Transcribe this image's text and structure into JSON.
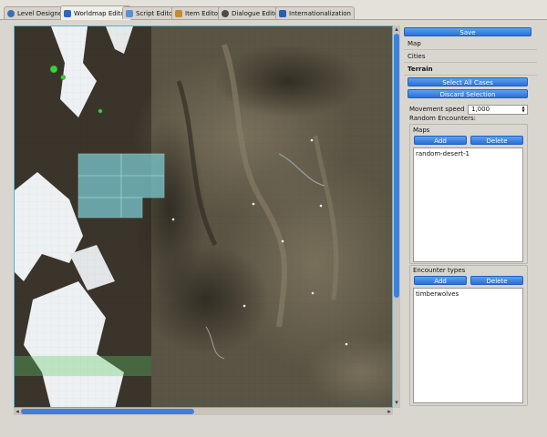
{
  "tabs": [
    {
      "label": "Level Designer",
      "icon": "globe-icon",
      "color": "#3a6fb0"
    },
    {
      "label": "Worldmap Editor",
      "icon": "map-flag-icon",
      "color": "#2d66c4",
      "active": true
    },
    {
      "label": "Script Editor",
      "icon": "script-icon",
      "color": "#5b8fd6"
    },
    {
      "label": "Item Editor",
      "icon": "box-icon",
      "color": "#c78a2d"
    },
    {
      "label": "Dialogue Editor",
      "icon": "speech-icon",
      "color": "#4a4a4a"
    },
    {
      "label": "Internationalization",
      "icon": "flag-icon",
      "color": "#2a5db8"
    }
  ],
  "panel": {
    "save_label": "Save",
    "sections": [
      "Map",
      "Cities",
      "Terrain"
    ],
    "select_all_label": "Select All Cases",
    "discard_label": "Discard Selection",
    "movement_speed_label": "Movement speed",
    "movement_speed_value": "1,000",
    "random_encounters_label": "Random Encounters:",
    "maps": {
      "title": "Maps",
      "add_label": "Add",
      "delete_label": "Delete",
      "items": [
        "random-desert-1"
      ]
    },
    "encounter_types": {
      "title": "Encounter types",
      "add_label": "Add",
      "delete_label": "Delete",
      "items": [
        "timberwolves"
      ]
    }
  },
  "colors": {
    "accent": "#2a70d6",
    "selection": "#7fd3dc",
    "city_marker": "#3ad13a"
  }
}
